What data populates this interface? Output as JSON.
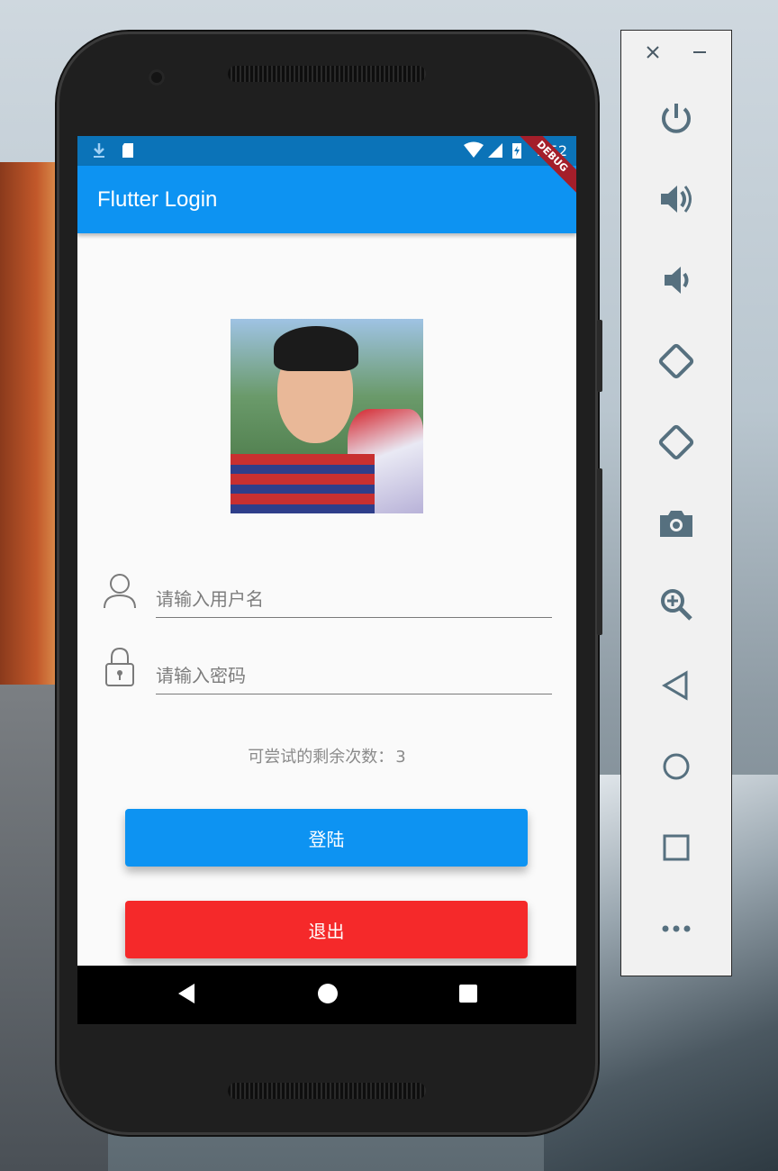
{
  "app": {
    "title": "Flutter Login",
    "debug_banner": "DEBUG",
    "status_time": "7:52"
  },
  "form": {
    "username_placeholder": "请输入用户名",
    "password_placeholder": "请输入密码",
    "attempts_label": "可尝试的剩余次数：",
    "attempts_count": "3"
  },
  "buttons": {
    "login_label": "登陆",
    "exit_label": "退出"
  },
  "icons": {
    "status_left": [
      "download-icon",
      "sd-card-icon"
    ],
    "status_right": [
      "wifi-icon",
      "signal-icon",
      "battery-charging-icon"
    ],
    "nav": [
      "back-icon",
      "home-icon",
      "recents-icon"
    ],
    "emulator": [
      "close-icon",
      "minimize-icon",
      "power-icon",
      "volume-up-icon",
      "volume-down-icon",
      "rotate-left-icon",
      "rotate-right-icon",
      "camera-icon",
      "zoom-icon",
      "back-icon",
      "home-icon",
      "overview-icon",
      "more-icon"
    ]
  },
  "colors": {
    "statusbar": "#0b73b8",
    "appbar": "#0d93f2",
    "login_button": "#0d93f2",
    "exit_button": "#f5292a",
    "debug_banner": "#a41e2a"
  }
}
